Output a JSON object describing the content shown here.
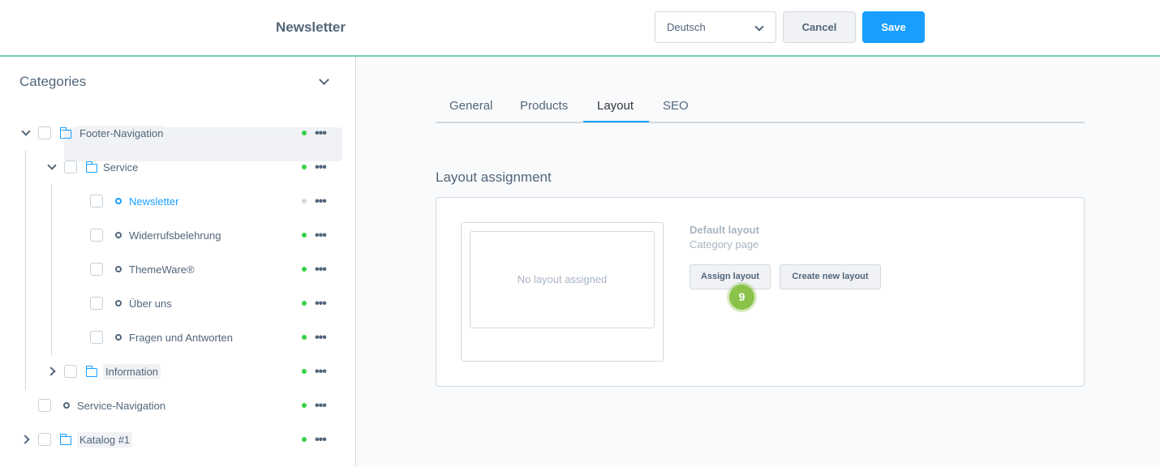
{
  "header": {
    "title": "Newsletter",
    "language": "Deutsch",
    "cancel_label": "Cancel",
    "save_label": "Save"
  },
  "sidebar": {
    "title": "Categories",
    "tree": {
      "footer_navigation": "Footer-Navigation",
      "service": "Service",
      "newsletter": "Newsletter",
      "widerrufsbelehrung": "Widerrufsbelehrung",
      "themeware": "ThemeWare®",
      "ueber_uns": "Über uns",
      "fragen": "Fragen und Antworten",
      "information": "Information",
      "service_navigation": "Service-Navigation",
      "katalog": "Katalog #1"
    },
    "more_symbol": "•••"
  },
  "tabs": [
    "General",
    "Products",
    "Layout",
    "SEO"
  ],
  "active_tab": "Layout",
  "layout_section": {
    "title": "Layout assignment",
    "preview_text": "No layout assigned",
    "default_layout_label": "Default layout",
    "layout_type": "Category page",
    "assign_label": "Assign layout",
    "create_label": "Create new layout",
    "step_badge": "9"
  },
  "colors": {
    "accent": "#189eff",
    "status_active": "#37d046",
    "header_border": "#6ed1a7",
    "badge": "#8bc34a"
  }
}
